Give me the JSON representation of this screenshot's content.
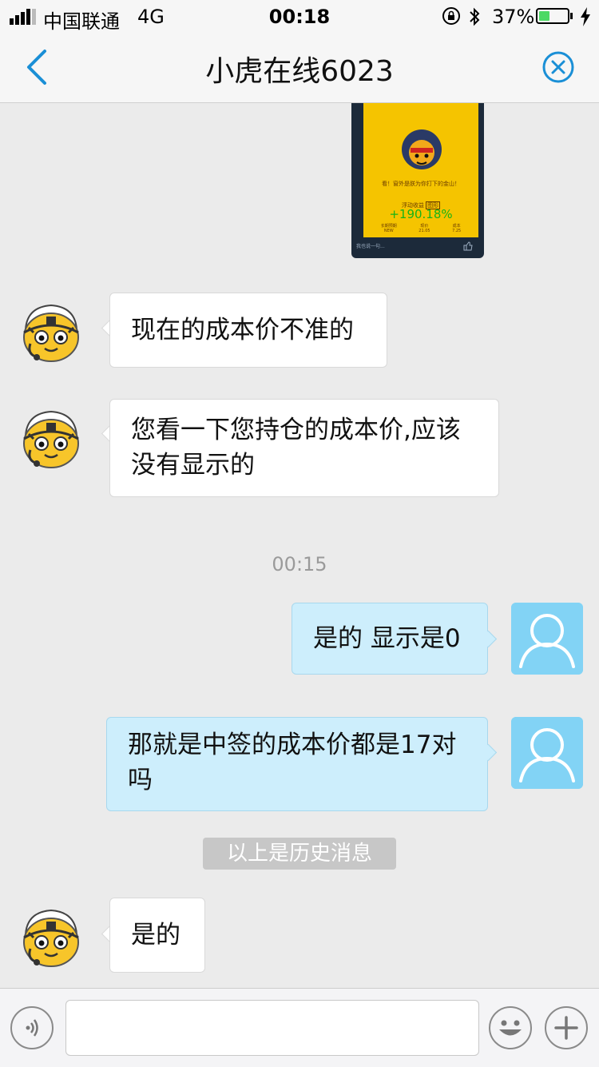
{
  "status_bar": {
    "carrier": "中国联通",
    "network": "4G",
    "time": "00:18",
    "battery_percent": "37%",
    "battery_level": 0.37
  },
  "nav": {
    "title": "小虎在线6023"
  },
  "shared_image": {
    "caption": "看！窗外是朕为你打下的金山！",
    "float_label": "浮动收益",
    "float_badge": "图形",
    "float_value": "+190.18%",
    "stats": [
      {
        "label": "长期预期",
        "value": "NEW"
      },
      {
        "label": "现价",
        "value": "21.05"
      },
      {
        "label": "成本",
        "value": "7.25"
      }
    ],
    "comment_placeholder": "我也说一句..."
  },
  "messages": [
    {
      "side": "in",
      "text": "现在的成本价不准的"
    },
    {
      "side": "in",
      "text": "您看一下您持仓的成本价,应该没有显示的"
    },
    {
      "side": "time",
      "text": "00:15"
    },
    {
      "side": "out",
      "text": "是的 显示是0"
    },
    {
      "side": "out",
      "text": "那就是中签的成本价都是17对吗"
    },
    {
      "side": "divider",
      "text": "以上是历史消息"
    },
    {
      "side": "in",
      "text": "是的"
    }
  ],
  "icons": {
    "back": "chevron-left-icon",
    "close": "close-circle-icon",
    "voice": "voice-icon",
    "emoji": "emoji-icon",
    "plus": "plus-icon",
    "signal": "signal-icon",
    "bluetooth": "bluetooth-icon",
    "rotation_lock": "rotation-lock-icon",
    "battery": "battery-icon",
    "charging": "charging-icon"
  },
  "colors": {
    "accent": "#1a8fd6",
    "outgoing_bubble": "#cdeefc",
    "user_avatar": "#82d3f5",
    "battery_fill": "#4cd964",
    "float_value": "#17b317"
  }
}
